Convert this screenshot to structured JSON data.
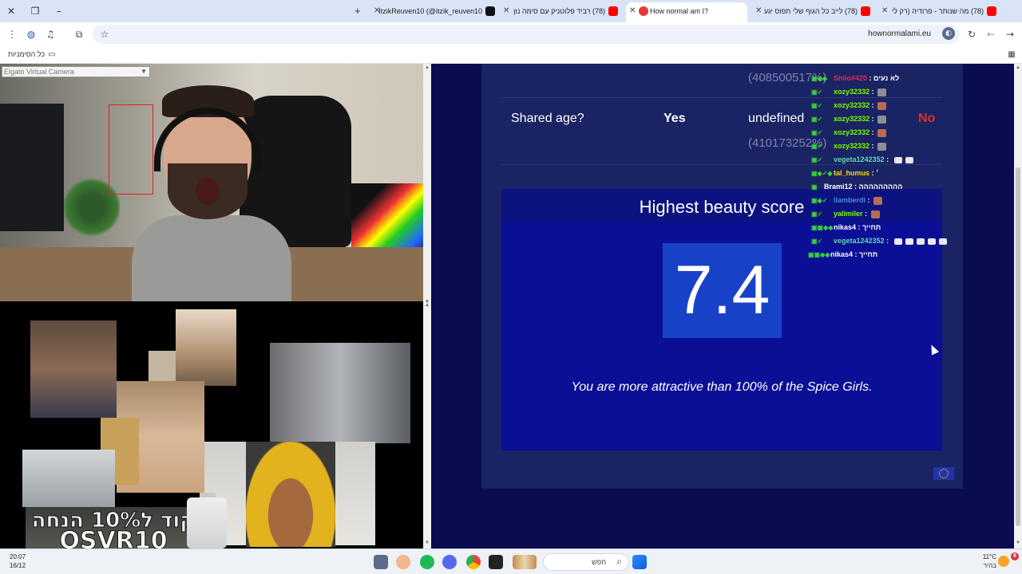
{
  "browser": {
    "tabs": [
      {
        "title": "ItzikReuven10 (@itzik_reuven10",
        "favicon_color": "#111111"
      },
      {
        "title": "(78) רביד פלוטניק עם סימה נון",
        "favicon_color": "#ff0000"
      },
      {
        "title": "How normal am I?",
        "favicon_color": "#e53935"
      },
      {
        "title": "(78) לייב כל הגוף שלי תפוס יגע",
        "favicon_color": "#ff0000"
      },
      {
        "title": "(78) מה שנותר - פרודיה (רק לי",
        "favicon_color": "#ff0000"
      }
    ],
    "url": "hownormalami.eu",
    "bookmarks_label": "כל הסימניות"
  },
  "stream": {
    "camera_select": "Elgato Virtual Camera",
    "promo_line1": "קוד ל10% הנחה",
    "promo_line2": "OSVR10"
  },
  "page": {
    "ghost_top": "(408500517%)",
    "shared_age_label": "Shared age?",
    "shared_age_value": "Yes",
    "undefined_label": "undefined",
    "no_label": "No",
    "ghost_mid": "(410173252%)",
    "beauty_title": "Highest beauty score",
    "beauty_score": "7.4",
    "comparison": "You are more attractive than 100% of the Spice Girls."
  },
  "chat": [
    {
      "user": "Shilo#420",
      "text": "לא נעים",
      "user_color": "#e0245e"
    },
    {
      "user": "xozy32332",
      "text": "",
      "user_color": "#7cfc00"
    },
    {
      "user": "xozy32332",
      "text": "",
      "user_color": "#7cfc00"
    },
    {
      "user": "xozy32332",
      "text": "",
      "user_color": "#7cfc00"
    },
    {
      "user": "xozy32332",
      "text": "",
      "user_color": "#7cfc00"
    },
    {
      "user": "xozy32332",
      "text": "",
      "user_color": "#7cfc00"
    },
    {
      "user": "vegeta1242352",
      "text": "",
      "user_color": "#5fd8b5"
    },
    {
      "user": "tal_humus",
      "text": "׳",
      "user_color": "#ffd700"
    },
    {
      "user": "Brami12",
      "text": "ההההההההה",
      "user_color": "#ffffff"
    },
    {
      "user": "liamberdi",
      "text": "",
      "user_color": "#4b86e8"
    },
    {
      "user": "yalimiler",
      "text": "",
      "user_color": "#7cfc00"
    },
    {
      "user": "nikas4",
      "text": "תחייך",
      "user_color": "#ffffff"
    },
    {
      "user": "vegeta1242352",
      "text": "",
      "user_color": "#5fd8b5"
    },
    {
      "user": "nikas4",
      "text": "תחייך",
      "user_color": "#ffffff"
    }
  ],
  "taskbar": {
    "time": "20:07",
    "date": "16/12",
    "search": "חפש",
    "temp": "11°C",
    "weather": "בהיר",
    "notif_count": "6"
  },
  "colors": {
    "accent": "#1742c7",
    "page_bg": "#0a0c52",
    "no": "#e32b2b"
  }
}
